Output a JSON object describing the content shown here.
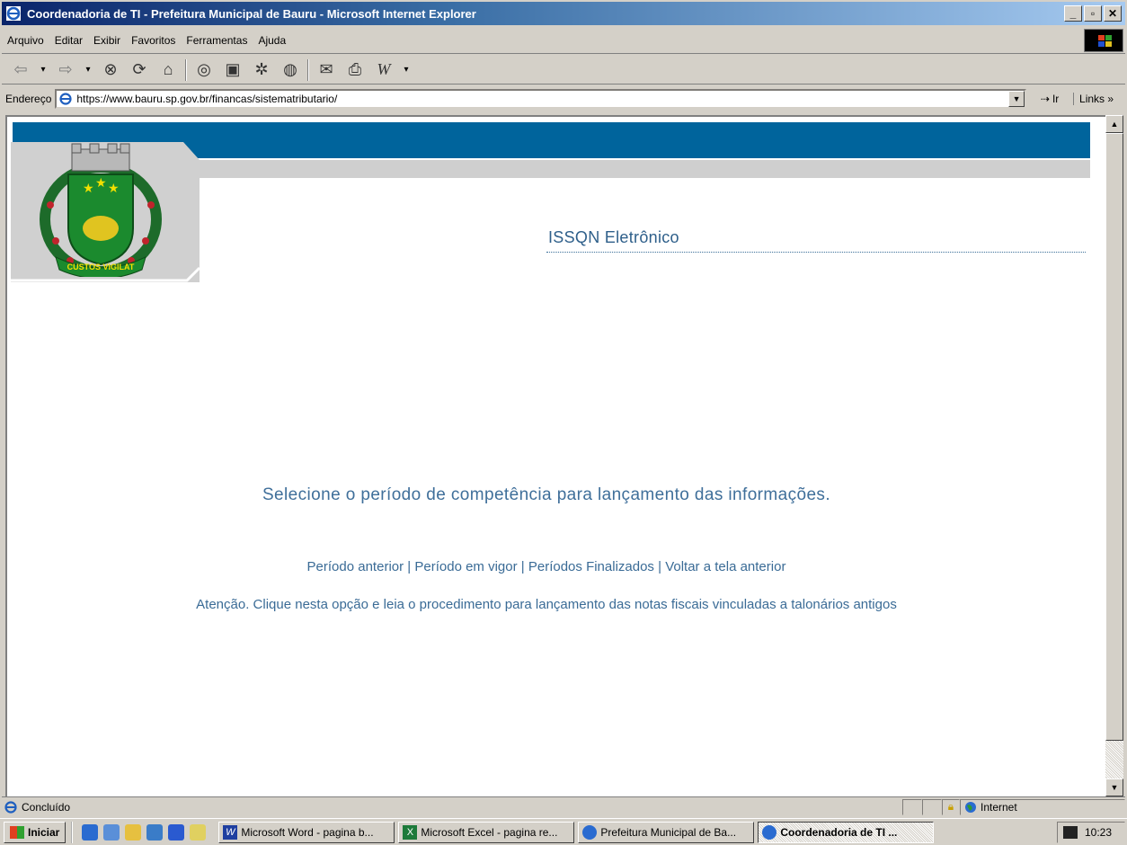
{
  "window": {
    "title": "Coordenadoria de TI - Prefeitura Municipal de Bauru - Microsoft Internet Explorer",
    "controls": {
      "minimize": "_",
      "maximize": "▫",
      "close": "✕"
    }
  },
  "menu": {
    "items": [
      "Arquivo",
      "Editar",
      "Exibir",
      "Favoritos",
      "Ferramentas",
      "Ajuda"
    ]
  },
  "toolbar": {
    "icons": [
      "back-icon",
      "forward-icon",
      "stop-icon",
      "refresh-icon",
      "home-icon",
      "search-icon",
      "favorites-icon",
      "history-icon",
      "media-icon",
      "mail-icon",
      "print-icon",
      "word-icon"
    ]
  },
  "address": {
    "label": "Endereço",
    "url": "https://www.bauru.sp.gov.br/financas/sistematributario/",
    "go_label": "Ir",
    "links_label": "Links »"
  },
  "page": {
    "section_title": "ISSQN Eletrônico",
    "instruction": "Selecione o período de competência para lançamento das informações.",
    "nav_links": [
      "Período anterior",
      "Período em vigor",
      "Períodos Finalizados",
      "Voltar a tela anterior"
    ],
    "separator": "|",
    "warning_link": "Atenção. Clique nesta opção e leia o procedimento para lançamento das notas fiscais vinculadas a talonários antigos",
    "logo_motto": "CUSTOS VIGILAT"
  },
  "statusbar": {
    "status": "Concluído",
    "zone": "Internet"
  },
  "taskbar": {
    "start_label": "Iniciar",
    "tasks": [
      {
        "label": "Microsoft Word - pagina b...",
        "icon": "word-icon",
        "active": false
      },
      {
        "label": "Microsoft Excel - pagina re...",
        "icon": "excel-icon",
        "active": false
      },
      {
        "label": "Prefeitura Municipal de Ba...",
        "icon": "ie-icon",
        "active": false
      },
      {
        "label": "Coordenadoria de TI ...",
        "icon": "ie-icon",
        "active": true
      }
    ],
    "clock": "10:23"
  },
  "colors": {
    "header_blue": "#00649c",
    "link_blue": "#3a6b96",
    "title_bar": "#0a246a"
  }
}
